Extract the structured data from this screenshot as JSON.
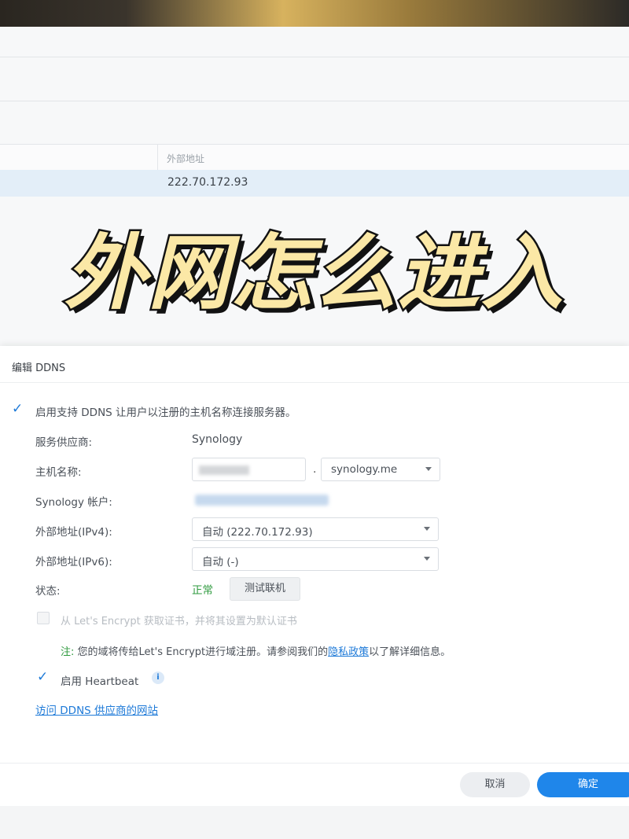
{
  "background_table": {
    "column_header": "外部地址",
    "row_value": "222.70.172.93"
  },
  "overlay_title": "外网怎么进入",
  "dialog": {
    "title": "编辑 DDNS",
    "enable_ddns_label": "启用支持 DDNS 让用户以注册的主机名称连接服务器。",
    "enable_ddns_checked": true,
    "fields": {
      "provider_label": "服务供应商:",
      "provider_value": "Synology",
      "hostname_label": "主机名称:",
      "hostname_separator": ".",
      "domain_value": "synology.me",
      "account_label": "Synology 帐户:",
      "ipv4_label": "外部地址(IPv4):",
      "ipv4_value": "自动 (222.70.172.93)",
      "ipv6_label": "外部地址(IPv6):",
      "ipv6_value": "自动 (-)",
      "status_label": "状态:",
      "status_value": "正常",
      "test_button": "测试联机"
    },
    "letsencrypt_label": "从 Let's Encrypt 获取证书，并将其设置为默认证书",
    "note_prefix": "注:",
    "note_text": "您的域将传给Let's Encrypt进行域注册。请参阅我们的",
    "note_link": "隐私政策",
    "note_suffix": "以了解详细信息。",
    "heartbeat_label": "启用 Heartbeat",
    "heartbeat_checked": true,
    "info_icon": "i",
    "visit_link": "访问 DDNS 供应商的网站",
    "cancel_button": "取消",
    "ok_button": "确定"
  },
  "colors": {
    "accent": "#1f86ea",
    "status_ok": "#2e9a3e",
    "title_fill": "#fbe8a6",
    "title_stroke": "#121212"
  }
}
